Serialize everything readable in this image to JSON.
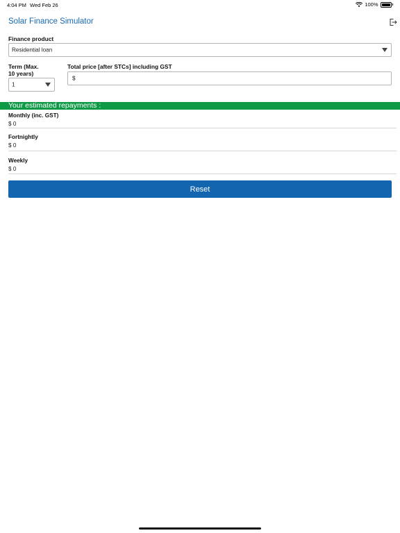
{
  "status_bar": {
    "time": "4:04 PM",
    "date": "Wed Feb 26",
    "battery": "100%"
  },
  "header": {
    "title": "Solar Finance Simulator",
    "logout_icon": "logout-icon"
  },
  "form": {
    "finance_product_label": "Finance product",
    "finance_product_value": "Residential loan",
    "term_label_line1": "Term (Max.",
    "term_label_line2": "10 years)",
    "term_value": "1",
    "price_label": "Total price [after STCs] including GST",
    "price_prefix": "$"
  },
  "repayments": {
    "banner": "Your estimated repayments :",
    "items": [
      {
        "label": "Monthly (inc. GST)",
        "value": "$ 0"
      },
      {
        "label": "Fortnightly",
        "value": "$ 0"
      },
      {
        "label": "Weekly",
        "value": "$ 0"
      }
    ]
  },
  "actions": {
    "reset_label": "Reset"
  },
  "colors": {
    "accent_blue": "#1465b0",
    "title_blue": "#1769b3",
    "banner_green": "#0e9a45"
  }
}
